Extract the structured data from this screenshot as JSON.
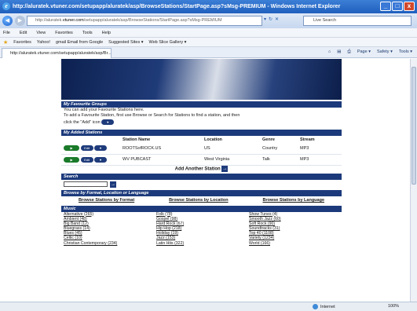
{
  "window": {
    "title": "http://aluratek.vtuner.com/setupapp/aluratek/asp/BrowseStations/StartPage.asp?sMsg-PREMIUM - Windows Internet Explorer",
    "minimize": "_",
    "maximize": "□",
    "close": "x"
  },
  "addressbar": {
    "url_prefix": "http://aluratek.",
    "url_domain": "vtuner.com",
    "url_rest": "/setupapp/aluratek/asp/BrowseStations/StartPage.asp?sMsg-PREMIUM",
    "search_placeholder": "Live Search"
  },
  "menu": [
    "File",
    "Edit",
    "View",
    "Favorites",
    "Tools",
    "Help"
  ],
  "favorites": {
    "label": "Favorites",
    "items": [
      "Yahoo!",
      "gmail Email from Google",
      "Suggested Sites ▾",
      "Web Slice Gallery ▾"
    ]
  },
  "tab": {
    "label": "http://aluratek.vtuner.com/setupapp/aluratek/asp/Br..."
  },
  "commandbar": [
    "Page ▾",
    "Safety ▾",
    "Tools ▾"
  ],
  "favourite_groups": {
    "heading": "My Favourite Groups",
    "line1": "You can add your Favourite Stations here.",
    "line2": "To add a Favourite Station, first use Browse or Search for Stations to find a station, and then",
    "line3": "click the \"Add\" icon"
  },
  "added_stations": {
    "heading": "My Added Stations",
    "columns": [
      "Station Name",
      "Location",
      "Genre",
      "Stream"
    ],
    "rows": [
      {
        "name": "ROOTSofROCK.US",
        "location": "US",
        "genre": "Country",
        "stream": "MP3"
      },
      {
        "name": "WV PUBCAST",
        "location": "West Virginia",
        "genre": "Talk",
        "stream": "MP3"
      }
    ],
    "add_label": "Add Another Station"
  },
  "search": {
    "heading": "Search"
  },
  "browse": {
    "heading": "Browse by Format, Location or Language",
    "links": [
      "Browse Stations by Format",
      "Browse Stations by Location",
      "Browse Stations by Language"
    ]
  },
  "music": {
    "heading": "Music",
    "genres": [
      "Alternative (265)",
      "Folk (78)",
      "Show Tunes (4)",
      "Ambient (48)",
      "Gospel (98)",
      "Smooth Jazz (60)",
      "Big Band (12)",
      "Hard Rock (67)",
      "Soft Rock (90)",
      "Bluegrass (14)",
      "Hip Hop (218)",
      "Soundtracks (31)",
      "Blues (45)",
      "Holiday (19)",
      "Top 40 (1108)",
      "Celtic (10)",
      "Jazz (153)",
      "Variety (1234)",
      "Christian Contemporary (234)",
      "Latin Hits (322)",
      "World (166)"
    ]
  },
  "status": {
    "zone": "Internet",
    "zoom": "100%"
  }
}
